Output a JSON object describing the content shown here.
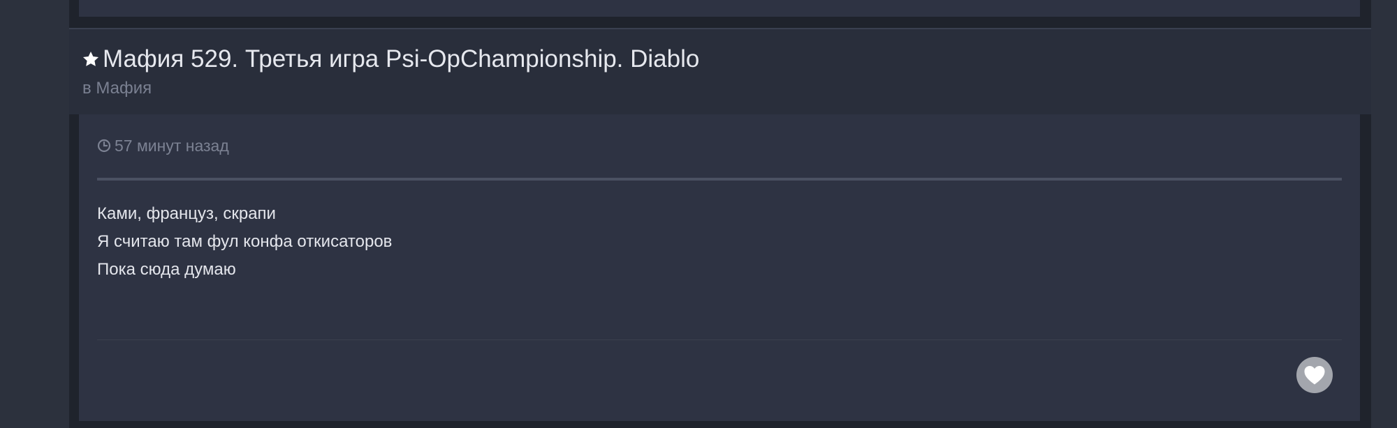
{
  "topic": {
    "title": "Мафия 529. Третья игра Psi-OpChampionship. Diablo",
    "forum": "в Мафия",
    "icon": "star-icon"
  },
  "post": {
    "time_icon": "clock-icon",
    "timestamp": "57 минут назад",
    "lines": [
      "Ками, француз, скрапи",
      "Я считаю там фул конфа откисаторов",
      "Пока сюда думаю"
    ],
    "like_icon": "heart-icon"
  },
  "colors": {
    "page_bg": "#2c313d",
    "card_bg": "#2e3343",
    "header_bg": "#292e3b",
    "title_text": "#e6e8ee",
    "muted_text": "#7c8293",
    "like_button": "#a3a6ad"
  }
}
